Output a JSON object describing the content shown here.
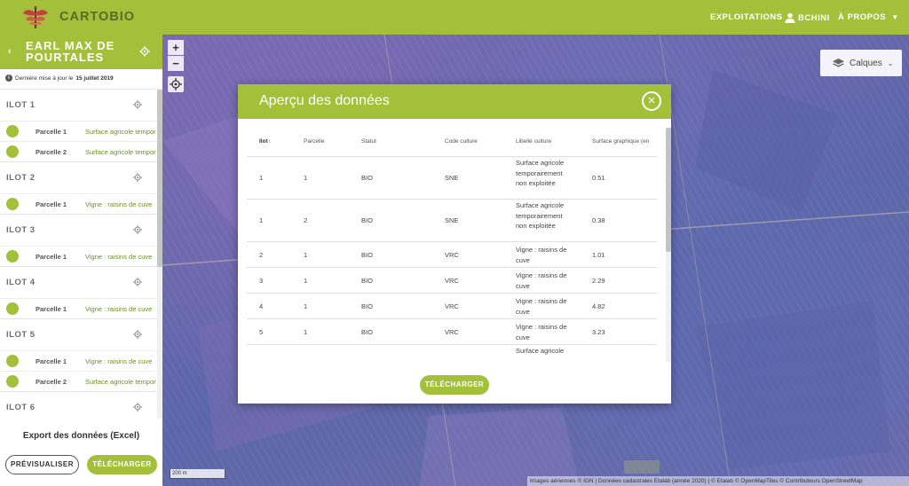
{
  "app": {
    "name": "CARTOBIO",
    "colors": {
      "primary": "#a4c03a",
      "brand_text": "#5b6a27",
      "map": "#6b6aa6"
    }
  },
  "nav": {
    "exploitations": "EXPLOITATIONS",
    "user": "BCHINI",
    "user_icon": "person-icon",
    "about": "À PROPOS",
    "about_icon": "caret-down-icon"
  },
  "sidebar": {
    "farm_name": "EARL MAX DE POURTALES",
    "update_prefix": "Dernière mise à jour le",
    "update_date": "15 juillet 2019",
    "ilots": [
      {
        "title": "ILOT 1",
        "parcelles": [
          {
            "name": "Parcelle 1",
            "culture": "Surface agricole temporairement non exploitée"
          },
          {
            "name": "Parcelle 2",
            "culture": "Surface agricole temporairement non exploitée"
          }
        ]
      },
      {
        "title": "ILOT 2",
        "parcelles": [
          {
            "name": "Parcelle 1",
            "culture": "Vigne : raisins de cuve"
          }
        ]
      },
      {
        "title": "ILOT 3",
        "parcelles": [
          {
            "name": "Parcelle 1",
            "culture": "Vigne : raisins de cuve"
          }
        ]
      },
      {
        "title": "ILOT 4",
        "parcelles": [
          {
            "name": "Parcelle 1",
            "culture": "Vigne : raisins de cuve"
          }
        ]
      },
      {
        "title": "ILOT 5",
        "parcelles": [
          {
            "name": "Parcelle 1",
            "culture": "Vigne : raisins de cuve"
          },
          {
            "name": "Parcelle 2",
            "culture": "Surface agricole temporairement non exploitée"
          }
        ]
      },
      {
        "title": "ILOT 6",
        "parcelles": []
      }
    ],
    "export_title": "Export des données (Excel)",
    "preview_label": "PRÉVISUALISER",
    "download_label": "TÉLÉCHARGER"
  },
  "map": {
    "zoom_in": "+",
    "zoom_out": "−",
    "layers_label": "Calques",
    "scale_label": "200 m",
    "attribution": "Images aériennes © IGN | Données cadastrales Etalab (année 2020) | © Etalab © OpenMapTiles © Contributeurs OpenStreetMap"
  },
  "modal": {
    "title": "Aperçu des données",
    "close": "×",
    "columns": [
      "Ilot",
      "Parcelle",
      "Statut",
      "Code culture",
      "Libellé culture",
      "Surface graphique (en"
    ],
    "sort_indicator": "↑",
    "rows": [
      {
        "ilot": "1",
        "parcelle": "1",
        "statut": "BIO",
        "code": "SNE",
        "libelle": "Surface agricole temporairement non exploitée",
        "surface": "0.51"
      },
      {
        "ilot": "1",
        "parcelle": "2",
        "statut": "BIO",
        "code": "SNE",
        "libelle": "Surface agricole temporairement non exploitée",
        "surface": "0.38"
      },
      {
        "ilot": "2",
        "parcelle": "1",
        "statut": "BIO",
        "code": "VRC",
        "libelle": "Vigne : raisins de cuve",
        "surface": "1.01"
      },
      {
        "ilot": "3",
        "parcelle": "1",
        "statut": "BIO",
        "code": "VRC",
        "libelle": "Vigne : raisins de cuve",
        "surface": "2.29"
      },
      {
        "ilot": "4",
        "parcelle": "1",
        "statut": "BIO",
        "code": "VRC",
        "libelle": "Vigne : raisins de cuve",
        "surface": "4.82"
      },
      {
        "ilot": "5",
        "parcelle": "1",
        "statut": "BIO",
        "code": "VRC",
        "libelle": "Vigne : raisins de cuve",
        "surface": "3.23"
      },
      {
        "ilot": "",
        "parcelle": "",
        "statut": "",
        "code": "",
        "libelle": "Surface agricole",
        "surface": ""
      }
    ],
    "download_label": "TÉLÉCHARGER"
  }
}
